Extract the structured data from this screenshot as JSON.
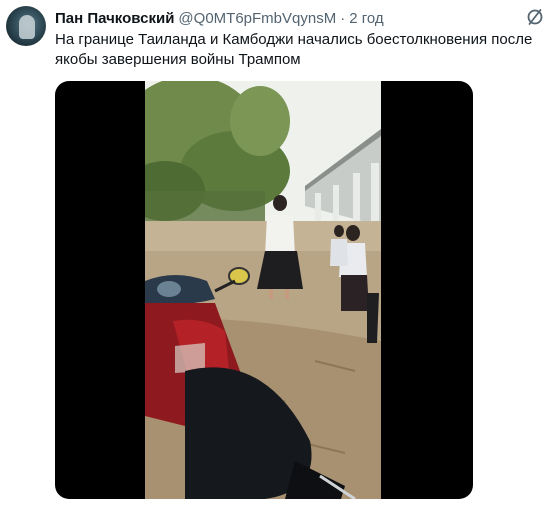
{
  "tweet": {
    "author_name": "Пан Пачковский",
    "author_handle": "@Q0MT6pFmbVqynsM",
    "separator": "·",
    "time": "2 год",
    "text": "На границе Таиланда и Камбоджи начались боестолкновения после якобы завершения войны  Трампом"
  },
  "icons": {
    "avatar": "avatar-image",
    "corner": "slashed-circle-icon"
  },
  "colors": {
    "name_text": "#0f1419",
    "secondary_text": "#536471",
    "media_background": "#000000"
  }
}
